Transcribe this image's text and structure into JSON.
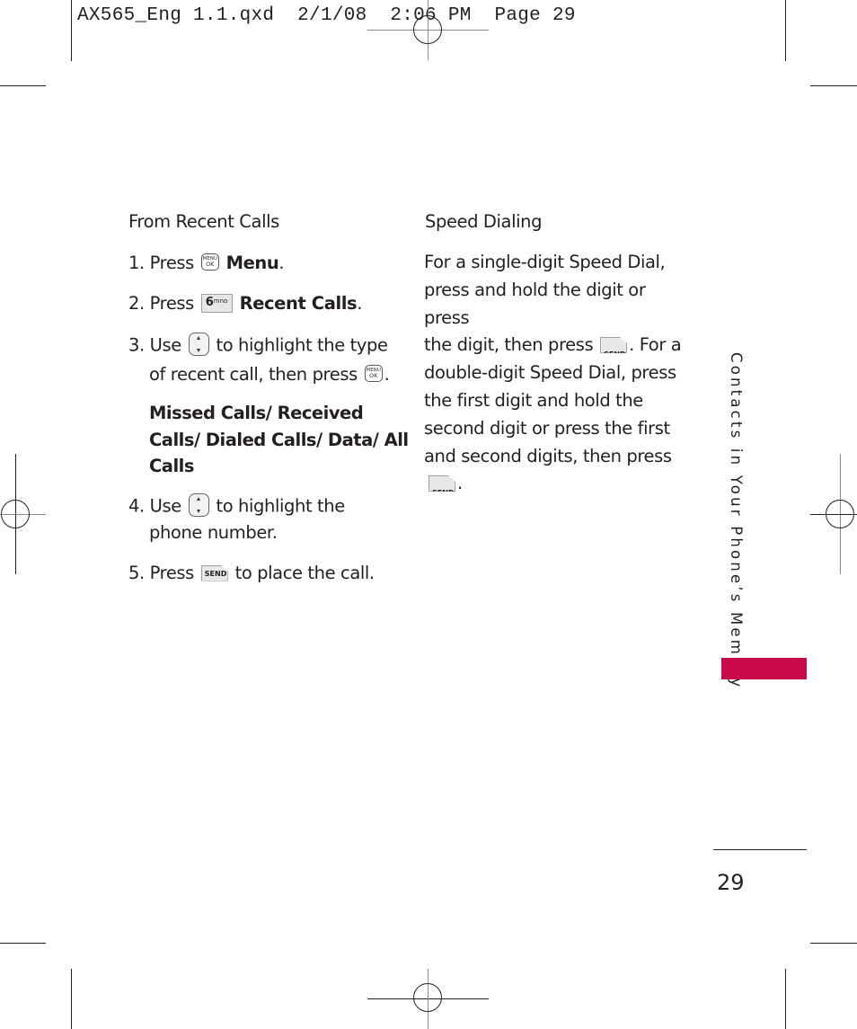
{
  "print_slug": "AX565_Eng 1.1.qxd  2/1/08  2:06 PM  Page 29",
  "left_column": {
    "heading": "From Recent Calls",
    "steps": [
      {
        "num": "1.",
        "pre": "Press",
        "key_icon": "menu-ok-key-icon",
        "key_text": [
          "MENU",
          "OK"
        ],
        "bold": "Menu",
        "post": "."
      },
      {
        "num": "2.",
        "pre": "Press",
        "key_icon": "six-mno-key-icon",
        "key_text": [
          "6",
          "mno"
        ],
        "bold": "Recent Calls",
        "post": "."
      },
      {
        "num": "3.",
        "pre": "Use",
        "key_icon": "navigation-key-icon",
        "post": "to highlight the type",
        "line2_pre": "of recent call, then press",
        "line2_key_text": [
          "MENU",
          "OK"
        ],
        "line2_post": "."
      },
      {
        "num": "4.",
        "pre": "Use",
        "key_icon": "navigation-key-icon",
        "post": "to highlight the",
        "line2_pre": "phone number."
      },
      {
        "num": "5.",
        "pre": "Press",
        "key_icon": "send-key-icon",
        "key_text": [
          "SEND"
        ],
        "post": "to place the call."
      }
    ],
    "options_lines": [
      "Missed Calls/ Received",
      "Calls/ Dialed Calls/ Data/ All",
      "Calls"
    ]
  },
  "right_column": {
    "heading": "Speed Dialing",
    "lines": [
      "For a single-digit Speed Dial,",
      "press and hold the digit or press",
      "the digit, then press",
      ". For a",
      "double-digit Speed Dial, press",
      "the first digit and hold the",
      "second digit or press the first",
      "and second digits, then press",
      "."
    ],
    "send_key_text": "SEND"
  },
  "sidebar": {
    "section_title": "Contacts in Your Phone’s Memory",
    "tab_color": "#c8094a"
  },
  "page_number": "29"
}
